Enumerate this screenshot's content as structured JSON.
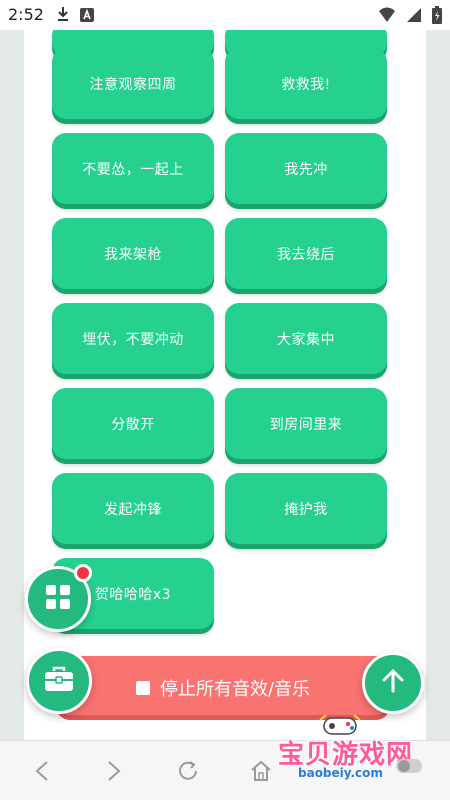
{
  "status_bar": {
    "time": "2:52",
    "icons": [
      "download-icon",
      "a-letter-icon",
      "wifi-icon",
      "signal-icon",
      "battery-icon"
    ]
  },
  "buttons": [
    {
      "label": ""
    },
    {
      "label": ""
    },
    {
      "label": "注意观察四周"
    },
    {
      "label": "救救我!"
    },
    {
      "label": "不要怂，一起上"
    },
    {
      "label": "我先冲"
    },
    {
      "label": "我来架枪"
    },
    {
      "label": "我去绕后"
    },
    {
      "label": "埋伏，不要冲动"
    },
    {
      "label": "大家集中"
    },
    {
      "label": "分散开"
    },
    {
      "label": "到房间里来"
    },
    {
      "label": "发起冲锋"
    },
    {
      "label": "掩护我"
    },
    {
      "label": "贺哈哈哈x3"
    }
  ],
  "stop_bar": {
    "label": "停止所有音效/音乐"
  },
  "floating": {
    "grid": "grid-icon",
    "toolbox": "toolbox-icon",
    "up": "arrow-up-icon"
  },
  "nav": [
    "back-icon",
    "forward-icon",
    "refresh-icon",
    "home-icon"
  ],
  "watermark": {
    "cn": "宝贝游戏网",
    "url": "baobeiy.com"
  },
  "colors": {
    "accent": "#26d08f",
    "accent_dark": "#1aa56d",
    "stop": "#f97370",
    "badge": "#ef3340"
  }
}
